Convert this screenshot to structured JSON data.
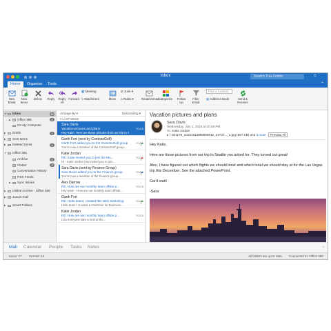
{
  "window": {
    "title": "Inbox",
    "search_placeholder": "Search This Folder"
  },
  "ribbon_tabs": [
    "Home",
    "Organize",
    "Tools"
  ],
  "ribbon": {
    "new_email": "New Email",
    "new_items": "New Items",
    "delete": "Delete",
    "reply": "Reply",
    "reply_all": "Reply All",
    "forward": "Forward",
    "meeting": "Meeting",
    "attachment": "Attachment",
    "move": "Move",
    "junk": "Junk",
    "rules": "Rules",
    "read_unread": "Read/Unread",
    "categorize": "Categorize",
    "follow_up": "Follow Up",
    "filter_email": "Filter Email",
    "find_contact": "Find a Contact",
    "address_book": "Address Book",
    "send_receive": "Send & Receive"
  },
  "folders": [
    {
      "label": "Inbox",
      "count": "12",
      "level": 0,
      "tri": "▼"
    },
    {
      "label": "Office 365",
      "count": "8",
      "level": 1,
      "tri": "▶"
    },
    {
      "label": "On My Computer",
      "count": "",
      "level": 1,
      "tri": ""
    },
    {
      "label": "Drafts",
      "count": "1",
      "level": 0,
      "tri": "▶"
    },
    {
      "label": "Sent Items",
      "count": "",
      "level": 0,
      "tri": "▶"
    },
    {
      "label": "Deleted Items",
      "count": "4",
      "level": 0,
      "tri": "▶"
    },
    {
      "label": "Office 365",
      "count": "",
      "level": 0,
      "tri": "▼"
    },
    {
      "label": "Archive",
      "count": "6",
      "level": 1,
      "tri": ""
    },
    {
      "label": "Clutter",
      "count": "3",
      "level": 1,
      "tri": ""
    },
    {
      "label": "Conversation History",
      "count": "",
      "level": 1,
      "tri": ""
    },
    {
      "label": "RSS Feeds",
      "count": "",
      "level": 1,
      "tri": ""
    },
    {
      "label": "Sync Issues",
      "count": "",
      "level": 1,
      "tri": "▶"
    },
    {
      "label": "Online Archive - Office 365",
      "count": "",
      "level": 0,
      "tri": "▶"
    },
    {
      "label": "Jura E-mail",
      "count": "",
      "level": 0,
      "tri": "▶"
    },
    {
      "label": "Smart Folders",
      "count": "",
      "level": 0,
      "tri": "▶"
    }
  ],
  "list": {
    "arrange_by": "Arrange By",
    "descending": "Descending",
    "group": "LAST WEEK",
    "messages": [
      {
        "sender": "Sara Davis",
        "subject": "Vacation pictures and plans",
        "preview": "Hey Katie, Here are those pictures from our trip to Seattle you",
        "date": "7/1/15",
        "selected": true,
        "bar": "",
        "flag": ""
      },
      {
        "sender": "Garth Fort (sent by ContosoGolf)",
        "subject": "Garth Fort added you to the ContosoGolf group",
        "preview": "You're now a member of the ContosoGolf group...",
        "date": "7/1/15",
        "selected": false,
        "bar": "",
        "flag": "#28a745"
      },
      {
        "sender": "Katie Jordan",
        "subject": "RE: Katie invited you to join the Ma...",
        "preview": "Hi - Katie Jordan has invited you to join...",
        "date": "7/1/15",
        "selected": false,
        "bar": "",
        "flag": "#e03c31"
      },
      {
        "sender": "Sara Davis (sent by Finance Group)",
        "subject": "Sara Davis added you to the Finance group",
        "preview": "You're now a member of the Finance group...",
        "date": "7/1/15",
        "selected": false,
        "bar": "#1f6fc5",
        "flag": "#1f6fc5"
      },
      {
        "sender": "Alex Darrow",
        "subject": "RE: How are our monthly team offsite p...",
        "preview": "Hey team - How are our monthly team offsite...",
        "date": "7/1/15",
        "selected": false,
        "bar": "",
        "flag": ""
      },
      {
        "sender": "Garth Fort",
        "subject": "RE: Hello team I created this Web Marketing",
        "preview": "Hello team I created a OneDrive for Business...",
        "date": "7/1/15",
        "selected": false,
        "bar": "",
        "flag": "#28a745"
      },
      {
        "sender": "Katie Jordan",
        "subject": "RE: How are our monthly team offsite p...",
        "preview": "Can everyone take a look at the...",
        "date": "7/1/15",
        "selected": false,
        "bar": "",
        "flag": ""
      }
    ]
  },
  "reading": {
    "subject": "Vacation pictures and plans",
    "from": "Sara Davis",
    "date": "Wednesday, July 1, 2015 at 10:59 PM",
    "to_label": "To:",
    "to": "Katie Jordan",
    "attachment": "841178_10151813888969842_34737..._o.jpg (587 KB) and",
    "attachment_more": "3 more",
    "preview_all": "Preview All",
    "greeting": "Hey Katie,",
    "para1": "Here are those pictures from our trip to Seattle you asked for. They turned out great!",
    "para2": "Also, I have figured out which flights we should book and which hotel we should stay at for the Las Vegas trip this December. See the attached PowerPoint.",
    "para3": "Can't wait!",
    "sign": "-Sara"
  },
  "nav": [
    "Mail",
    "Calendar",
    "People",
    "Tasks",
    "Notes"
  ],
  "status": {
    "items": "Items: 27",
    "unread": "Unread: 12",
    "sync": "All folders are up to date.",
    "connected": "Connected to: Office 365"
  }
}
